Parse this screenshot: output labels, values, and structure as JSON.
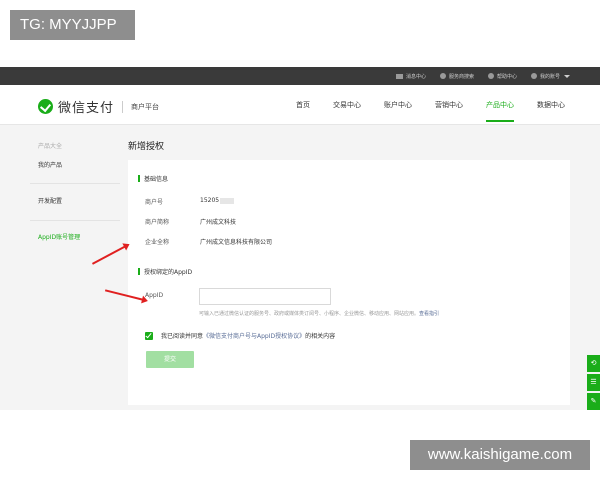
{
  "watermarks": {
    "top": "TG: MYYJJPP",
    "bottom": "www.kaishigame.com"
  },
  "topbar": {
    "items": [
      {
        "icon": "mail-icon",
        "label": "消息中心"
      },
      {
        "icon": "service-icon",
        "label": "服务商搜索"
      },
      {
        "icon": "help-icon",
        "label": "帮助中心"
      },
      {
        "icon": "user-icon",
        "label": "我的账号"
      }
    ]
  },
  "header": {
    "logo_text": "微信支付",
    "platform": "商户平台",
    "nav": [
      "首页",
      "交易中心",
      "账户中心",
      "营销中心",
      "产品中心",
      "数据中心"
    ],
    "active_nav": "产品中心"
  },
  "sidebar": {
    "group_label": "产品大全",
    "my_products": "我的产品",
    "dev_config": "开发配置",
    "appid_manage": "AppID账号管理"
  },
  "page_title": "新增授权",
  "basic_info": {
    "heading": "基础信息",
    "rows": [
      {
        "label": "商户号",
        "value": "15205"
      },
      {
        "label": "商户简称",
        "value": "广州成文科技"
      },
      {
        "label": "企业全称",
        "value": "广州成文信息科技有限公司"
      }
    ]
  },
  "appid_section": {
    "heading": "授权绑定的AppID",
    "label": "AppID",
    "input_value": "",
    "hint": "可输入已通过微信认证的服务号、政府或媒体类订阅号、小程序、企业微信、移动应用、网站应用。",
    "hint_link": "查看指引"
  },
  "agreement": {
    "prefix": "我已阅读并同意",
    "link": "《微信支付商户号与AppID授权协议》",
    "suffix": "的相关内容"
  },
  "submit_label": "提交",
  "colors": {
    "accent": "#1aad19",
    "link": "#576b95",
    "arrow": "#e02020",
    "topbar": "#3a3a3a"
  }
}
